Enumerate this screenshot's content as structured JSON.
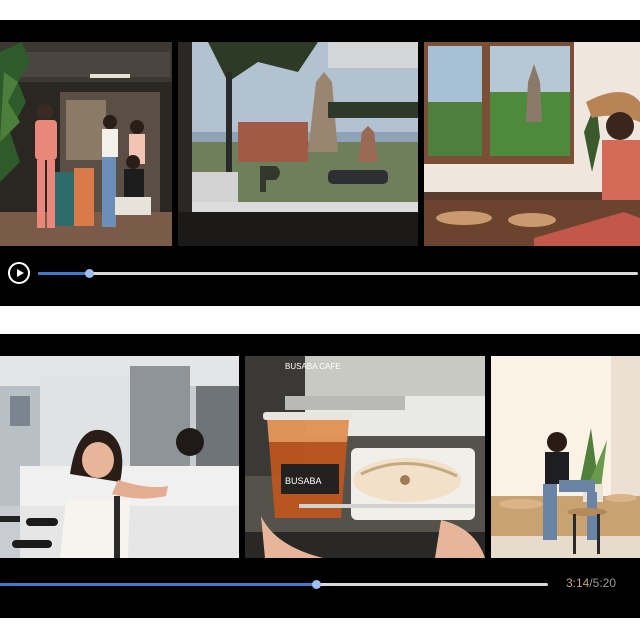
{
  "players": [
    {
      "frames": [
        {
          "scene": "cafe-storefront-group-photo"
        },
        {
          "scene": "temple-ruins-through-window"
        },
        {
          "scene": "woman-seated-by-window-temple-view"
        }
      ],
      "progress_fraction": 0.086
    },
    {
      "frames": [
        {
          "scene": "woman-at-cafe-counter"
        },
        {
          "scene": "iced-tea-and-dessert"
        },
        {
          "scene": "woman-sitting-on-stool"
        }
      ],
      "progress_fraction": 0.577,
      "current_time": "3:14",
      "separator": "/",
      "total_time": "5:20"
    }
  ],
  "frame_texts": {
    "cup_brand": "BUSABA",
    "storefront_sign": "BUSABA CAFE"
  },
  "icons": {
    "play": "play-icon"
  },
  "colors": {
    "player_background": "#000000",
    "progress_played": "#3d7bd1",
    "progress_unplayed": "#d9d9d9",
    "progress_knob": "#9fc0ee",
    "current_time": "#c8a27a",
    "total_time": "#9a9a9a"
  }
}
